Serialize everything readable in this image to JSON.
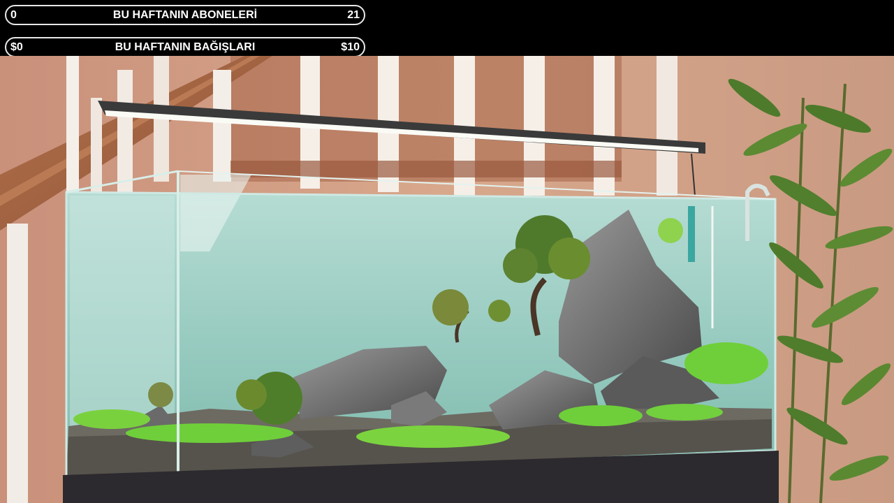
{
  "overlay": {
    "subscribers": {
      "start": "0",
      "title": "BU HAFTANIN ABONELERİ",
      "goal": "21"
    },
    "donations": {
      "start": "$0",
      "title": "BU HAFTANIN BAĞIŞLARI",
      "goal": "$10"
    }
  },
  "colors": {
    "overlay_background": "#000000",
    "overlay_border": "#e8e8e8",
    "overlay_text": "#ffffff",
    "wall": "#d9a98a",
    "water": "#9ccfc4",
    "plants": "#6fcf3a"
  }
}
